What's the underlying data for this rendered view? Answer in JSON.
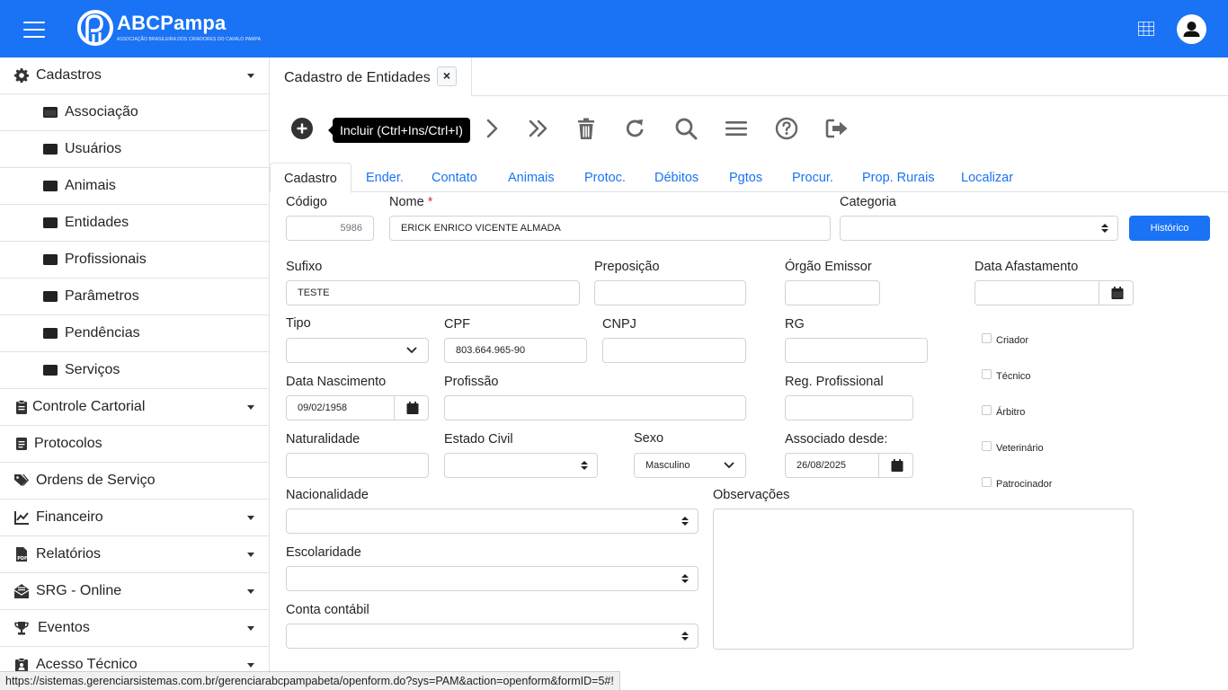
{
  "brand": {
    "name": "ABCPampa",
    "subtitle": "ASSOCIAÇÃO BRASILEIRA DOS CRIADORES DO CAVALO PAMPA",
    "primary_color": "#1a73f5"
  },
  "topbar": {
    "menu_icon": "hamburger-icon",
    "apps_icon": "grid-icon",
    "user_icon": "user-avatar-icon"
  },
  "sidebar": {
    "items": [
      {
        "label": "Cadastros",
        "icon": "gear-icon",
        "expanded": true
      },
      {
        "label": "Associação",
        "icon": "card-icon"
      },
      {
        "label": "Usuários",
        "icon": "card-icon"
      },
      {
        "label": "Animais",
        "icon": "card-icon"
      },
      {
        "label": "Entidades",
        "icon": "card-icon"
      },
      {
        "label": "Profissionais",
        "icon": "card-icon"
      },
      {
        "label": "Parâmetros",
        "icon": "card-icon"
      },
      {
        "label": "Pendências",
        "icon": "card-icon"
      },
      {
        "label": "Serviços",
        "icon": "card-icon"
      },
      {
        "label": "Controle Cartorial",
        "icon": "clipboard-icon"
      },
      {
        "label": "Protocolos",
        "icon": "document-icon"
      },
      {
        "label": "Ordens de Serviço",
        "icon": "tags-icon"
      },
      {
        "label": "Financeiro",
        "icon": "line-chart-icon"
      },
      {
        "label": "Relatórios",
        "icon": "pdf-icon"
      },
      {
        "label": "SRG - Online",
        "icon": "envelope-open-icon"
      },
      {
        "label": "Eventos",
        "icon": "trophy-icon"
      },
      {
        "label": "Acesso Técnico",
        "icon": "clipboard-user-icon"
      }
    ]
  },
  "form_tab": {
    "title": "Cadastro de Entidades",
    "close": "×"
  },
  "toolbar": {
    "tooltip": "Incluir (Ctrl+Ins/Ctrl+I)"
  },
  "tabs": [
    "Cadastro",
    "Ender.",
    "Contato",
    "Animais",
    "Protoc.",
    "Débitos",
    "Pgtos",
    "Procur.",
    "Prop. Rurais",
    "Localizar"
  ],
  "fields": {
    "codigo": {
      "label": "Código",
      "value": "5986"
    },
    "nome": {
      "label": "Nome",
      "required": "*",
      "value": "ERICK ENRICO VICENTE ALMADA"
    },
    "categoria": {
      "label": "Categoria",
      "value": ""
    },
    "historico_button": "Histórico",
    "sufixo": {
      "label": "Sufixo",
      "value": "TESTE"
    },
    "preposicao": {
      "label": "Preposição",
      "value": ""
    },
    "orgao_emissor": {
      "label": "Órgão Emissor",
      "value": ""
    },
    "data_afastamento": {
      "label": "Data Afastamento",
      "value": ""
    },
    "tipo": {
      "label": "Tipo",
      "value": ""
    },
    "cpf": {
      "label": "CPF",
      "value": "803.664.965-90"
    },
    "cnpj": {
      "label": "CNPJ",
      "value": ""
    },
    "rg": {
      "label": "RG",
      "value": ""
    },
    "data_nascimento": {
      "label": "Data Nascimento",
      "value": "09/02/1958"
    },
    "profissao": {
      "label": "Profissão",
      "value": ""
    },
    "reg_profissional": {
      "label": "Reg. Profissional",
      "value": ""
    },
    "naturalidade": {
      "label": "Naturalidade",
      "value": ""
    },
    "estado_civil": {
      "label": "Estado Civil",
      "value": ""
    },
    "sexo": {
      "label": "Sexo",
      "value": "Masculino"
    },
    "associado_desde": {
      "label": "Associado desde:",
      "value": "26/08/2025"
    },
    "nacionalidade": {
      "label": "Nacionalidade",
      "value": ""
    },
    "observacoes": {
      "label": "Observações",
      "value": ""
    },
    "escolaridade": {
      "label": "Escolaridade",
      "value": ""
    },
    "conta_contabil": {
      "label": "Conta contábil",
      "value": ""
    }
  },
  "checkboxes": [
    {
      "label": "Criador",
      "checked": false
    },
    {
      "label": "Técnico",
      "checked": false
    },
    {
      "label": "Árbitro",
      "checked": false
    },
    {
      "label": "Veterinário",
      "checked": false
    },
    {
      "label": "Patrocinador",
      "checked": false
    }
  ],
  "status_url": "https://sistemas.gerenciarsistemas.com.br/gerenciarabcpampabeta/openform.do?sys=PAM&action=openform&formID=5#!"
}
